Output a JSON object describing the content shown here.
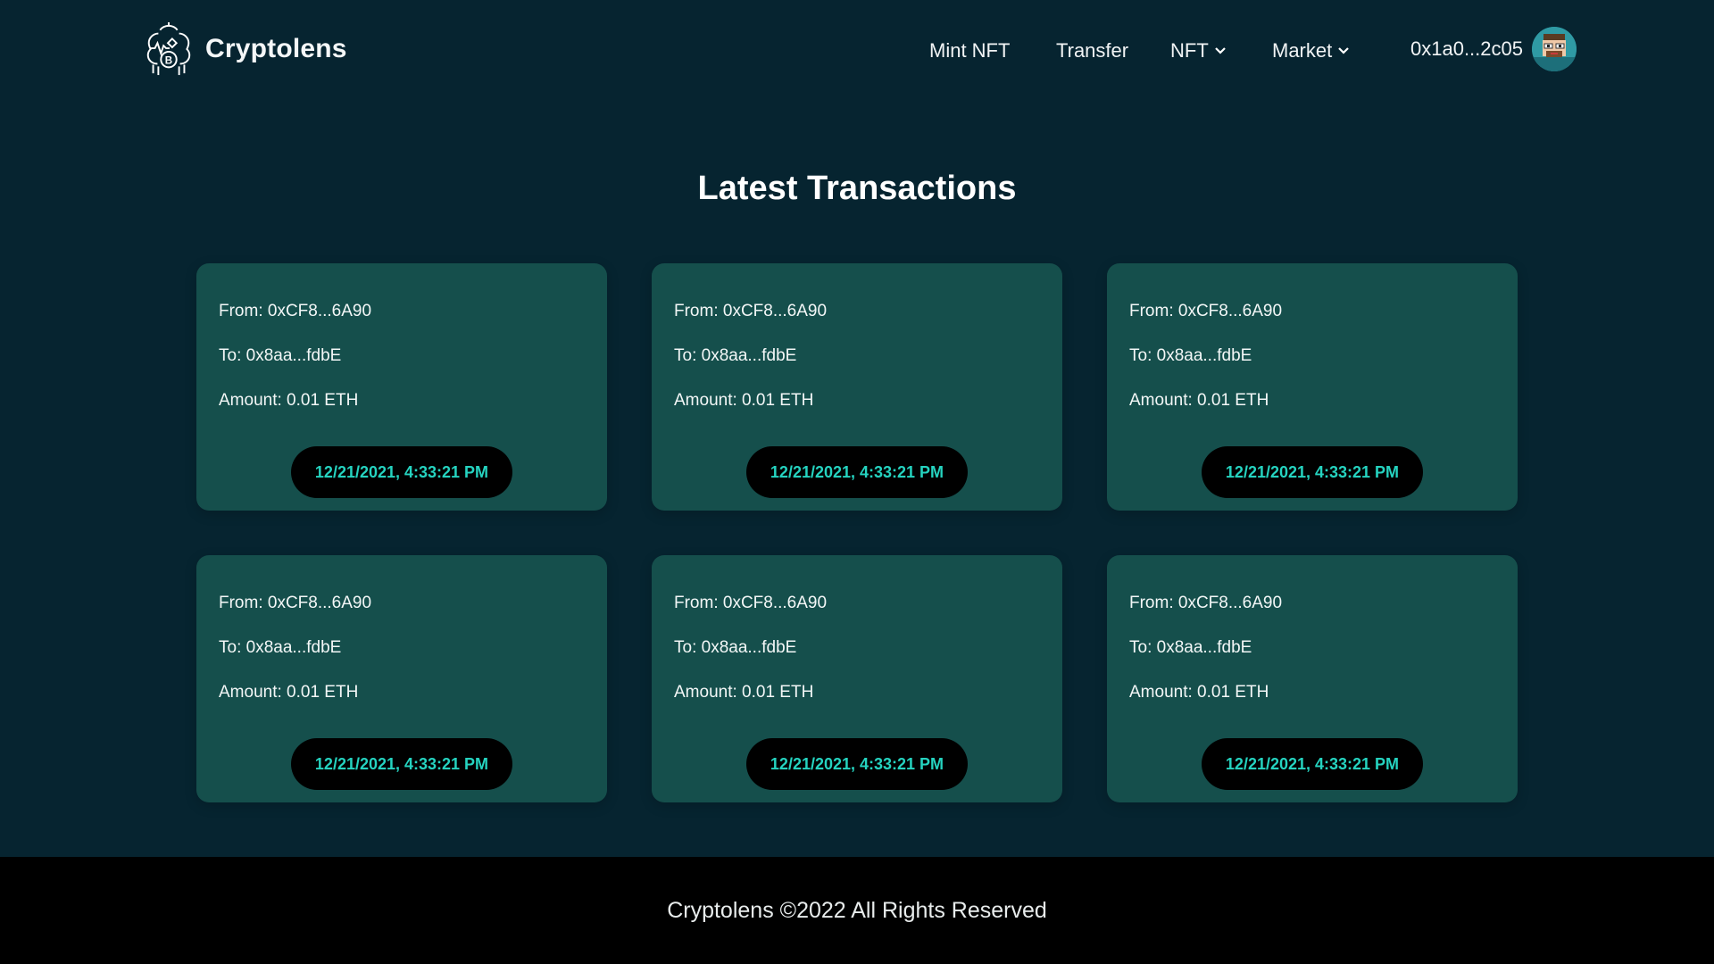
{
  "brand": {
    "name": "Cryptolens",
    "logo_icon": "crypto-brain-icon"
  },
  "nav": {
    "mint": "Mint NFT",
    "transfer": "Transfer",
    "nft": "NFT",
    "market": "Market",
    "wallet_address": "0x1a0...2c05"
  },
  "page": {
    "title": "Latest Transactions"
  },
  "transactions": [
    {
      "from": "From: 0xCF8...6A90",
      "to": "To: 0x8aa...fdbE",
      "amount": "Amount: 0.01 ETH",
      "timestamp": "12/21/2021, 4:33:21 PM"
    },
    {
      "from": "From: 0xCF8...6A90",
      "to": "To: 0x8aa...fdbE",
      "amount": "Amount: 0.01 ETH",
      "timestamp": "12/21/2021, 4:33:21 PM"
    },
    {
      "from": "From: 0xCF8...6A90",
      "to": "To: 0x8aa...fdbE",
      "amount": "Amount: 0.01 ETH",
      "timestamp": "12/21/2021, 4:33:21 PM"
    },
    {
      "from": "From: 0xCF8...6A90",
      "to": "To: 0x8aa...fdbE",
      "amount": "Amount: 0.01 ETH",
      "timestamp": "12/21/2021, 4:33:21 PM"
    },
    {
      "from": "From: 0xCF8...6A90",
      "to": "To: 0x8aa...fdbE",
      "amount": "Amount: 0.01 ETH",
      "timestamp": "12/21/2021, 4:33:21 PM"
    },
    {
      "from": "From: 0xCF8...6A90",
      "to": "To: 0x8aa...fdbE",
      "amount": "Amount: 0.01 ETH",
      "timestamp": "12/21/2021, 4:33:21 PM"
    }
  ],
  "footer": {
    "text": "Cryptolens ©2022 All Rights Reserved"
  },
  "colors": {
    "background": "#062430",
    "card": "#154f4c",
    "accent": "#25d3c0",
    "footer": "#000000"
  }
}
